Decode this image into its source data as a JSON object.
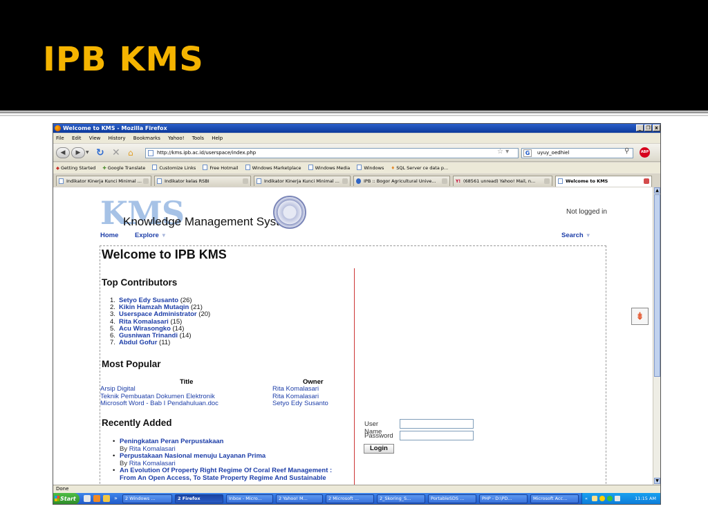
{
  "slide": {
    "title": "IPB KMS"
  },
  "window": {
    "title": "Welcome to KMS - Mozilla Firefox",
    "buttons": {
      "minimize": "_",
      "maximize": "❐",
      "close": "x"
    }
  },
  "menu": [
    "File",
    "Edit",
    "View",
    "History",
    "Bookmarks",
    "Yahoo!",
    "Tools",
    "Help"
  ],
  "nav": {
    "url": "http://kms.ipb.ac.id/userspace/index.php",
    "search_value": "uyuy_oedhiel"
  },
  "bookmarks": [
    "Getting Started",
    "Google Translate",
    "Customize Links",
    "Free Hotmail",
    "Windows Marketplace",
    "Windows Media",
    "Windows",
    "SQL Server ce data p..."
  ],
  "tabs": [
    {
      "label": "Indikator Kinerja Kunci Minimal ..."
    },
    {
      "label": "Indikator kelas RSBI"
    },
    {
      "label": "Indikator Kinerja Kunci Minimal ..."
    },
    {
      "label": "IPB :: Bogor Agricultural Unive..."
    },
    {
      "label": "(68561 unread) Yahoo! Mail, n..."
    },
    {
      "label": "Welcome to KMS"
    }
  ],
  "page": {
    "logo_letters": "KMS",
    "logo_text": "Knowledge Management System",
    "login_status": "Not logged in",
    "nav": {
      "home": "Home",
      "explore": "Explore",
      "search": "Search",
      "caret": "▼"
    },
    "welcome": "Welcome to IPB KMS",
    "top_contributors": {
      "heading": "Top Contributors",
      "items": [
        {
          "num": "1.",
          "name": "Setyo Edy Susanto",
          "count": "(26)"
        },
        {
          "num": "2.",
          "name": "Kikin Hamzah Mutaqin",
          "count": "(21)"
        },
        {
          "num": "3.",
          "name": "Userspace Administrator",
          "count": "(20)"
        },
        {
          "num": "4.",
          "name": "Rita Komalasari",
          "count": "(15)"
        },
        {
          "num": "5.",
          "name": "Acu Wirasongko",
          "count": "(14)"
        },
        {
          "num": "6.",
          "name": "Gusniwan Trinandi",
          "count": "(14)"
        },
        {
          "num": "7.",
          "name": "Abdul Gofur",
          "count": "(11)"
        }
      ]
    },
    "most_popular": {
      "heading": "Most Popular",
      "col_title": "Title",
      "col_owner": "Owner",
      "rows": [
        {
          "title": "Arsip Digital",
          "owner": "Rita Komalasari"
        },
        {
          "title": "Teknik Pembuatan Dokumen Elektronik",
          "owner": "Rita Komalasari"
        },
        {
          "title": "Microsoft Word - Bab I Pendahuluan.doc",
          "owner": "Setyo Edy Susanto"
        }
      ]
    },
    "recently_added": {
      "heading": "Recently Added",
      "bullet": "•",
      "by_label": "By",
      "items": [
        {
          "title": "Peningkatan Peran Perpustakaan",
          "author": "Rita Komalasari"
        },
        {
          "title": "Perpustakaan Nasional menuju Layanan Prima",
          "author": "Rita Komalasari"
        },
        {
          "title": "An Evolution Of Property Right Regime Of Coral Reef Management :",
          "title2": "From An Open Access, To State Property Regime And Sustainable"
        }
      ]
    },
    "login": {
      "user_label": "User Name",
      "password_label": "Password",
      "button": "Login"
    }
  },
  "status": {
    "text": "Done"
  },
  "taskbar": {
    "start": "Start",
    "buttons": [
      "2 Windows ...",
      "2 Firefox",
      "Inbox - Micro...",
      "2 Yahoo! M...",
      "2 Microsoft ...",
      "2_Skoring_S...",
      "PortableSDS ...",
      "PHP - D:\\PD...",
      "Microsoft Acc..."
    ],
    "clock": "11:15 AM"
  }
}
